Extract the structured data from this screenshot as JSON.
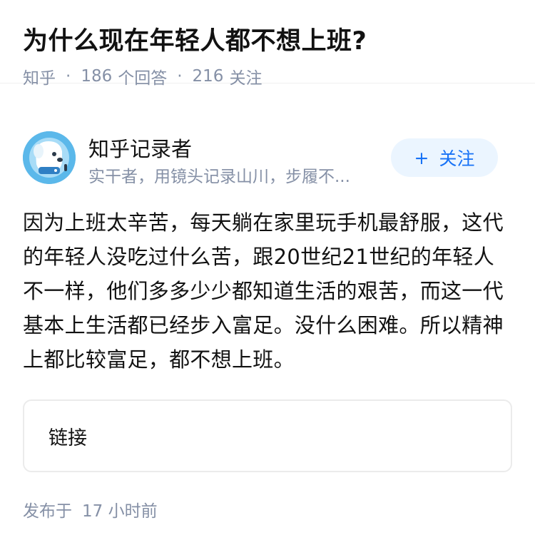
{
  "question": {
    "title": "为什么现在年轻人都不想上班?",
    "source": "知乎",
    "answer_count": "186",
    "answer_label": "个回答",
    "follower_count": "216",
    "follower_label": "关注"
  },
  "author": {
    "name": "知乎记录者",
    "bio": "实干者，用镜头记录山川，步履不...",
    "follow_label": "关注",
    "follow_icon": "plus-icon",
    "avatar_color": "#56b4e6"
  },
  "answer": {
    "content": "因为上班太辛苦，每天躺在家里玩手机最舒服，这代的年轻人没吃过什么苦，跟20世纪21世纪的年轻人不一样，他们多多少少都知道生活的艰苦，而这一代基本上生活都已经步入富足。没什么困难。所以精神上都比较富足，都不想上班。",
    "link_label": "链接",
    "published_label": "发布于",
    "published_time": "17 小时前"
  },
  "colors": {
    "accent": "#1772f6",
    "accent_bg": "#ebf5ff",
    "meta_text": "#8590a6"
  }
}
